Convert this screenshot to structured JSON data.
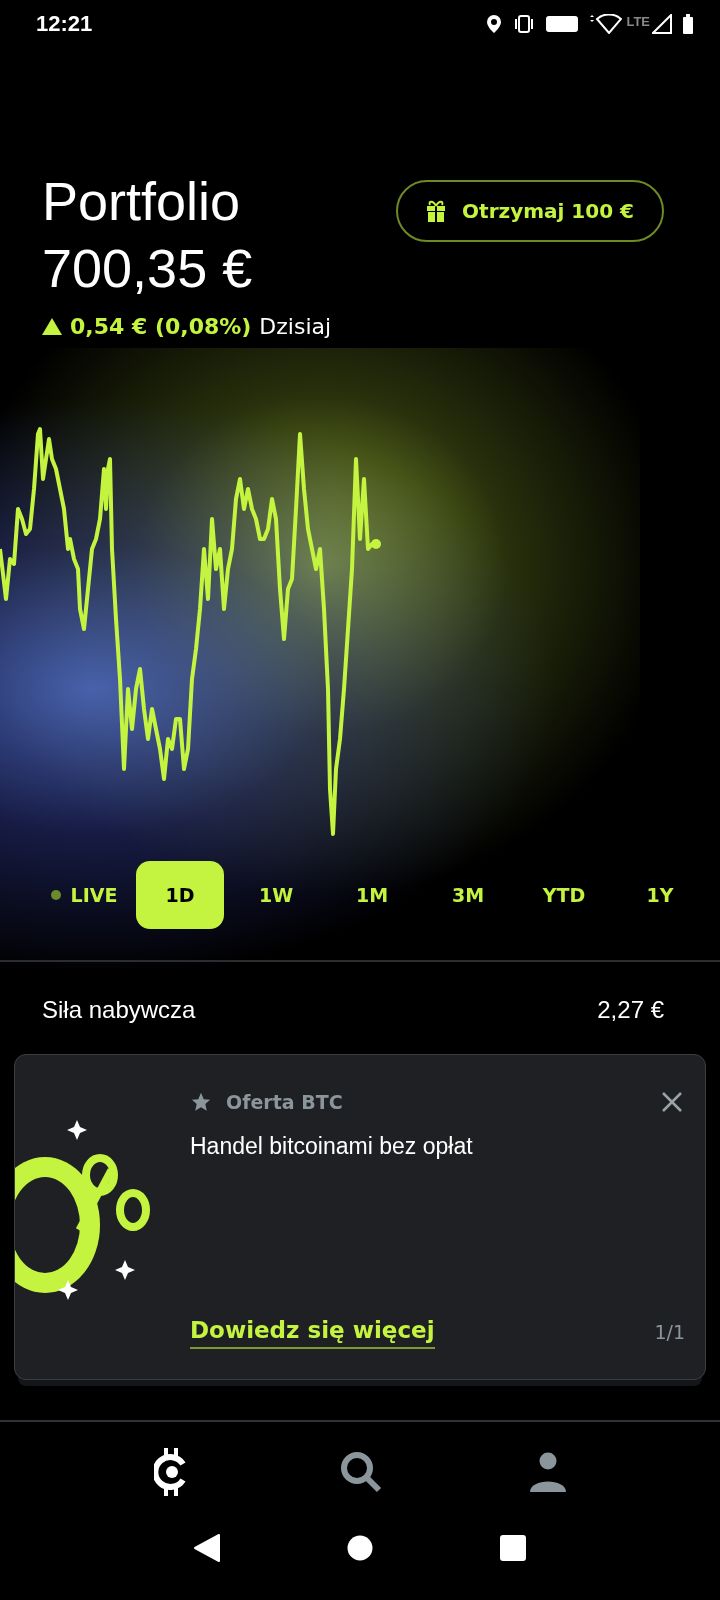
{
  "status_bar": {
    "time": "12:21",
    "network": "LTE"
  },
  "header": {
    "title": "Portfolio",
    "value": "700,35 €",
    "change": "0,54 € (0,08%)",
    "rising": true,
    "period": "Dzisiaj",
    "referral_button": "Otrzymaj 100 €"
  },
  "ranges": [
    {
      "label": "LIVE",
      "kind": "live",
      "selected": false
    },
    {
      "label": "1D",
      "kind": "range",
      "selected": true
    },
    {
      "label": "1W",
      "kind": "range",
      "selected": false
    },
    {
      "label": "1M",
      "kind": "range",
      "selected": false
    },
    {
      "label": "3M",
      "kind": "range",
      "selected": false
    },
    {
      "label": "YTD",
      "kind": "range",
      "selected": false
    },
    {
      "label": "1Y",
      "kind": "range",
      "selected": false
    }
  ],
  "buying_power": {
    "label": "Siła nabywcza",
    "value": "2,27 €"
  },
  "promo": {
    "tag": "Oferta BTC",
    "text": "Handel bitcoinami bez opłat",
    "link": "Dowiedz się więcej",
    "pager": "1/1"
  },
  "bottom_nav": [
    {
      "kind": "home",
      "selected": true
    },
    {
      "kind": "search",
      "selected": false
    },
    {
      "kind": "profile",
      "selected": false
    }
  ]
}
